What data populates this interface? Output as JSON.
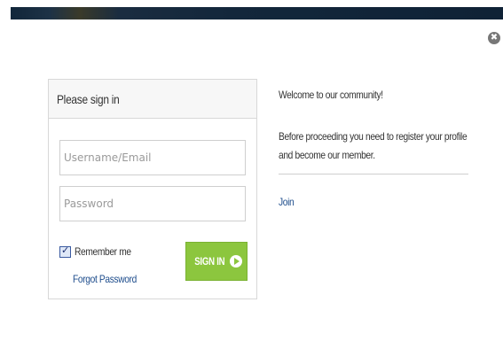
{
  "dialog": {
    "close_glyph": "✖"
  },
  "signin": {
    "title": "Please sign in",
    "username_placeholder": "Username/Email",
    "password_placeholder": "Password",
    "remember_label": "Remember me",
    "remember_checked": true,
    "forgot_label": "Forgot Password",
    "button_label": "SIGN IN",
    "button_color": "#8cc63e"
  },
  "welcome_panel": {
    "welcome_text": "Welcome to our community!",
    "info_text": "Before proceeding you need to register your profile and become our member.",
    "join_label": "Join",
    "link_color": "#1e4d8c"
  }
}
